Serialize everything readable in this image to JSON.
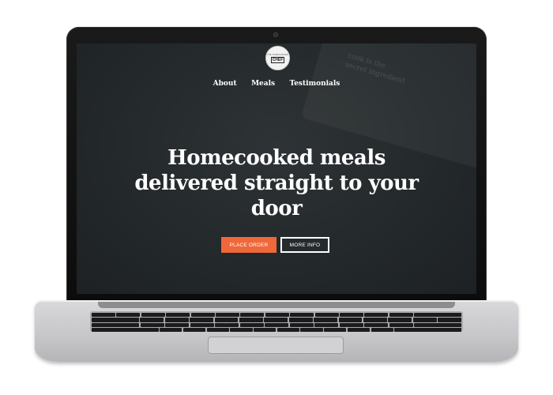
{
  "logo": {
    "top_text": "THE HOMECOOKED",
    "mid_text": "CHEF"
  },
  "nav": {
    "items": [
      {
        "label": "About"
      },
      {
        "label": "Meals"
      },
      {
        "label": "Testimonials"
      }
    ]
  },
  "hero": {
    "headline_line1": "Homecooked meals",
    "headline_line2": "delivered straight to your",
    "headline_line3": "door",
    "primary_button": "PLACE ORDER",
    "secondary_button": "MORE INFO"
  },
  "background_text": "cook is the\nsecret ingredient",
  "colors": {
    "accent": "#f0673a",
    "screen_bg": "#23282a",
    "text": "#ffffff"
  }
}
